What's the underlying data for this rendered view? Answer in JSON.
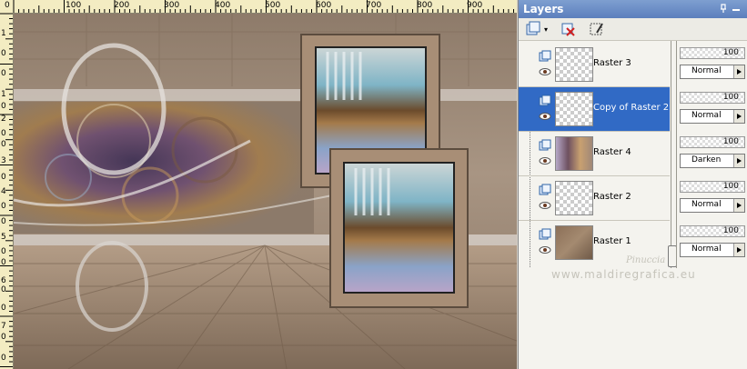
{
  "rulers": {
    "top_labels": [
      "0",
      "100",
      "200",
      "300",
      "400",
      "500",
      "600",
      "700",
      "800",
      "900"
    ],
    "left_labels": [
      "1",
      "0",
      "0",
      "1",
      "0",
      "2",
      "0",
      "0",
      "3",
      "0",
      "4",
      "0",
      "0",
      "5",
      "0",
      "0",
      "6",
      "0",
      "0",
      "7",
      "0",
      "0"
    ]
  },
  "panel": {
    "title": "Layers"
  },
  "layers": [
    {
      "name": "Raster 3",
      "opacity": "100",
      "blend": "Normal",
      "selected": false,
      "thumb": "transparent"
    },
    {
      "name": "Copy of Raster 2",
      "opacity": "100",
      "blend": "Normal",
      "selected": true,
      "thumb": "transparent"
    },
    {
      "name": "Raster 4",
      "opacity": "100",
      "blend": "Darken",
      "selected": false,
      "thumb": "art"
    },
    {
      "name": "Raster 2",
      "opacity": "100",
      "blend": "Normal",
      "selected": false,
      "thumb": "transparent"
    },
    {
      "name": "Raster 1",
      "opacity": "100",
      "blend": "Normal",
      "selected": false,
      "thumb": "texture"
    }
  ],
  "watermark": {
    "line1": "Pinuccia",
    "line2": "www.maldiregrafica.eu"
  },
  "colors": {
    "selection": "#316ac5",
    "title_bar": "#6a8cc6",
    "canvas_bg": "#a28f7d"
  }
}
